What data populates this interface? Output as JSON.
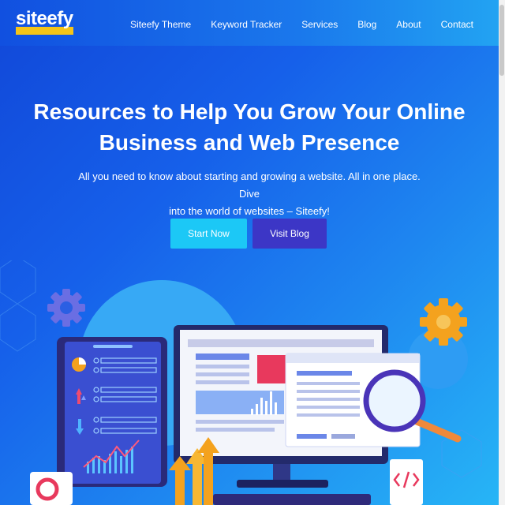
{
  "brand": {
    "logo_text": "siteefy",
    "accent_color": "#f5c518"
  },
  "nav": {
    "items": [
      {
        "label": "Siteefy Theme"
      },
      {
        "label": "Keyword Tracker"
      },
      {
        "label": "Services"
      },
      {
        "label": "Blog"
      },
      {
        "label": "About"
      },
      {
        "label": "Contact"
      }
    ]
  },
  "hero": {
    "title_line1": "Resources to Help You Grow Your Online",
    "title_line2": "Business and Web Presence",
    "subtitle_line1": "All you need to know about starting and growing a website. All in one place. Dive",
    "subtitle_line2": "into the world of websites – Siteefy!",
    "primary_button": "Start Now",
    "secondary_button": "Visit Blog"
  },
  "colors": {
    "background_start": "#1147d8",
    "background_end": "#27b6f6",
    "start_button": "#1cc8f6",
    "blog_button": "#3c36c6"
  },
  "illustration": {
    "icons": [
      "gear-icon",
      "gear-icon",
      "monitor-icon",
      "tablet-icon",
      "magnifier-icon",
      "pie-chart-icon",
      "code-icon",
      "location-pin-icon",
      "growth-arrows-icon"
    ]
  }
}
